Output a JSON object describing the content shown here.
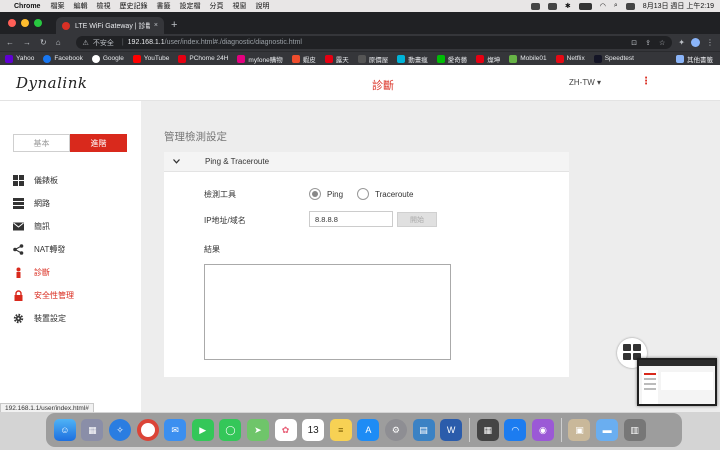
{
  "menubar": {
    "app_name": "Chrome",
    "menus": [
      "檔案",
      "編輯",
      "檢視",
      "歷史記錄",
      "書籤",
      "設定檔",
      "分頁",
      "視窗",
      "說明"
    ],
    "datetime": "8月13日 週日 上午2:19"
  },
  "tab": {
    "title": "LTE WiFi Gateway | 診斷",
    "close": "×",
    "new_tab": "+"
  },
  "address": {
    "security_label": "不安全",
    "host": "192.168.1.1",
    "path": "/user/index.html#./diagnostic/diagnostic.html"
  },
  "bookmarks": [
    {
      "label": "Yahoo",
      "color": "#6001d2"
    },
    {
      "label": "Facebook",
      "color": "#1877f2"
    },
    {
      "label": "Google",
      "color": "#ffffff"
    },
    {
      "label": "YouTube",
      "color": "#ff0000"
    },
    {
      "label": "PChome 24H",
      "color": "#e60012"
    },
    {
      "label": "myfone購物",
      "color": "#e4007f"
    },
    {
      "label": "蝦皮",
      "color": "#ee4d2d"
    },
    {
      "label": "露天",
      "color": "#e60012"
    },
    {
      "label": "原價屋",
      "color": "#555555"
    },
    {
      "label": "動畫瘋",
      "color": "#00b4d8"
    },
    {
      "label": "愛奇藝",
      "color": "#00be06"
    },
    {
      "label": "燦坤",
      "color": "#e60012"
    },
    {
      "label": "Mobile01",
      "color": "#67b346"
    },
    {
      "label": "Netflix",
      "color": "#e50914"
    },
    {
      "label": "Speedtest",
      "color": "#141526"
    }
  ],
  "bookmarks_other": "其他書籤",
  "header": {
    "logo": "Dynalink",
    "title": "診斷",
    "language": "ZH-TW ▾",
    "menu_glyph": "⋮"
  },
  "modes": {
    "basic": "基本",
    "advanced": "進階"
  },
  "sidebar": {
    "items": [
      {
        "label": "儀錶板",
        "icon": "dashboard-icon",
        "active": false
      },
      {
        "label": "網路",
        "icon": "network-icon",
        "active": false
      },
      {
        "label": "簡訊",
        "icon": "sms-icon",
        "active": false
      },
      {
        "label": "NAT轉發",
        "icon": "share-icon",
        "active": false
      },
      {
        "label": "診斷",
        "icon": "diagnostic-icon",
        "active": true
      },
      {
        "label": "安全性管理",
        "icon": "lock-icon",
        "active": true
      },
      {
        "label": "裝置設定",
        "icon": "gear-icon",
        "active": false
      }
    ]
  },
  "main": {
    "section_title": "管理檢測設定",
    "panel_title": "Ping & Traceroute",
    "tool_label": "檢測工具",
    "tool_options": [
      "Ping",
      "Traceroute"
    ],
    "tool_selected": "Ping",
    "ip_label": "IP地址/域名",
    "ip_value": "8.8.8.8",
    "start_button": "開始",
    "result_label": "結果",
    "result_value": ""
  },
  "status_url": "192.168.1.1/user/index.html#",
  "colors": {
    "accent": "#d9291c",
    "content_bg": "#ededed"
  }
}
